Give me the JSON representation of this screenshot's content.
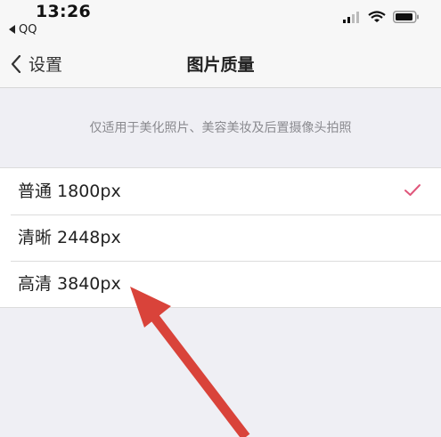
{
  "status_bar": {
    "time": "13:26",
    "back_app": "QQ",
    "icons": [
      "signal-icon",
      "wifi-icon",
      "battery-icon"
    ]
  },
  "nav": {
    "back_label": "设置",
    "title": "图片质量"
  },
  "hint": "仅适用于美化照片、美容美妆及后置摄像头拍照",
  "options": [
    {
      "label": "普通 1800px",
      "selected": true
    },
    {
      "label": "清晰 2448px",
      "selected": false
    },
    {
      "label": "高清 3840px",
      "selected": false
    }
  ],
  "colors": {
    "check": "#e0567b",
    "annotation_arrow": "#d9433a",
    "background": "#efeff4"
  }
}
